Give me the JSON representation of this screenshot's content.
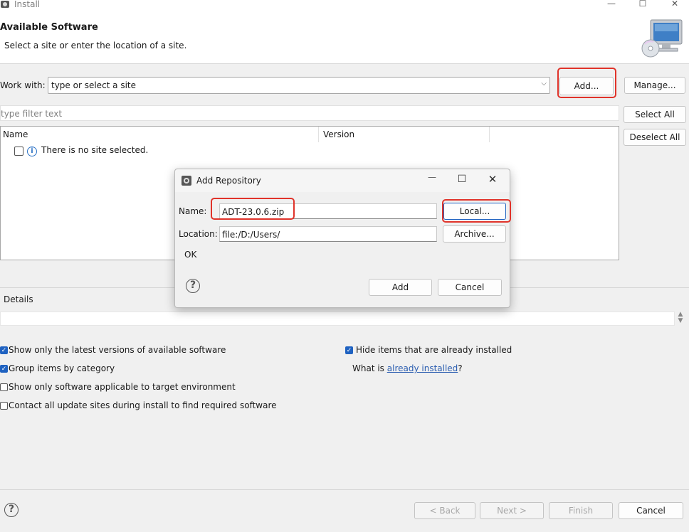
{
  "window": {
    "title": "Install",
    "minimize_icon": "minimize-icon",
    "maximize_icon": "maximize-icon",
    "close_icon": "close-icon"
  },
  "header": {
    "title": "Available Software",
    "subtitle": "Select a site or enter the location of a site.",
    "graphic_icon": "computer-cd-icon"
  },
  "work_with": {
    "label": "Work with:",
    "value": "type or select a site",
    "add_label": "Add...",
    "manage_label": "Manage..."
  },
  "filter": {
    "placeholder": "type filter text",
    "select_all_label": "Select All",
    "deselect_all_label": "Deselect All"
  },
  "table": {
    "columns": [
      "Name",
      "Version"
    ],
    "empty_message": "There is no site selected."
  },
  "details": {
    "label": "Details"
  },
  "options": {
    "show_latest": {
      "label": "Show only the latest versions of available software",
      "checked": true
    },
    "group_by_category": {
      "label": "Group items by category",
      "checked": true
    },
    "show_applicable": {
      "label": "Show only software applicable to target environment",
      "checked": false
    },
    "contact_all": {
      "label": "Contact all update sites during install to find required software",
      "checked": false
    },
    "hide_installed": {
      "label": "Hide items that are already installed",
      "checked": true
    },
    "what_is_prefix": "What is ",
    "what_is_link": "already installed",
    "what_is_suffix": "?"
  },
  "buttons": {
    "back": "< Back",
    "next": "Next >",
    "finish": "Finish",
    "cancel": "Cancel"
  },
  "dialog": {
    "title": "Add Repository",
    "name_label": "Name:",
    "name_value": "ADT-23.0.6.zip",
    "local_label": "Local...",
    "location_label": "Location:",
    "location_value": "file:/D:/Users/",
    "archive_label": "Archive...",
    "status": "OK",
    "add_label": "Add",
    "cancel_label": "Cancel"
  },
  "colors": {
    "highlight": "#e0332a",
    "checkbox": "#1f62c1",
    "link": "#2a5db0"
  }
}
